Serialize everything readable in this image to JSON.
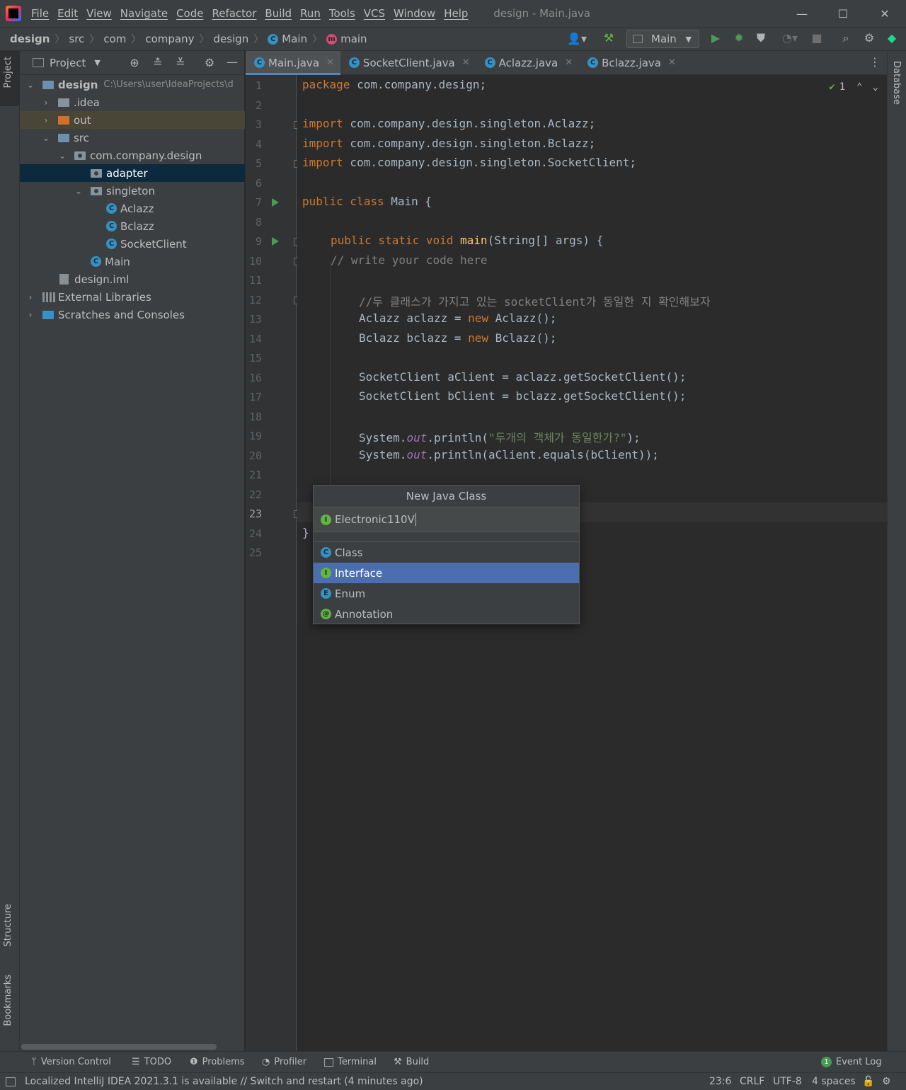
{
  "app": {
    "window_title": "design - Main.java",
    "menu": [
      "File",
      "Edit",
      "View",
      "Navigate",
      "Code",
      "Refactor",
      "Build",
      "Run",
      "Tools",
      "VCS",
      "Window",
      "Help"
    ],
    "window_controls": {
      "minimize": "—",
      "maximize": "☐",
      "close": "✕"
    }
  },
  "breadcrumbs": [
    "design",
    "src",
    "com",
    "company",
    "design",
    "Main",
    "main"
  ],
  "toolbar": {
    "run_config": "Main",
    "icons": [
      "user-icon",
      "hammer-icon",
      "run-icon",
      "debug-icon",
      "coverage-icon",
      "profile-icon",
      "stop-icon",
      "search-icon",
      "gear-icon",
      "jetbrains-icon"
    ]
  },
  "left_stripe": {
    "project_tab": "Project",
    "structure_tab": "Structure",
    "bookmarks_tab": "Bookmarks"
  },
  "right_stripe": {
    "database_tab": "Database"
  },
  "project_panel": {
    "title": "Project",
    "root_name": "design",
    "root_path": "C:\\Users\\user\\IdeaProjects\\d",
    "items": [
      {
        "label": ".idea",
        "type": "folder"
      },
      {
        "label": "out",
        "type": "folder-orange"
      },
      {
        "label": "src",
        "type": "folder-blue"
      },
      {
        "label": "com.company.design",
        "type": "package"
      },
      {
        "label": "adapter",
        "type": "package"
      },
      {
        "label": "singleton",
        "type": "package"
      },
      {
        "label": "Aclazz",
        "type": "class"
      },
      {
        "label": "Bclazz",
        "type": "class"
      },
      {
        "label": "SocketClient",
        "type": "class"
      },
      {
        "label": "Main",
        "type": "class-main"
      },
      {
        "label": "design.iml",
        "type": "file"
      },
      {
        "label": "External Libraries",
        "type": "library"
      },
      {
        "label": "Scratches and Consoles",
        "type": "scratch"
      }
    ]
  },
  "tabs": [
    {
      "label": "Main.java",
      "active": true
    },
    {
      "label": "SocketClient.java",
      "active": false
    },
    {
      "label": "Aclazz.java",
      "active": false
    },
    {
      "label": "Bclazz.java",
      "active": false
    }
  ],
  "editor": {
    "inspection_count": "1",
    "current_line": 23,
    "line_numbers": [
      "1",
      "2",
      "3",
      "4",
      "5",
      "6",
      "7",
      "8",
      "9",
      "10",
      "11",
      "12",
      "13",
      "14",
      "15",
      "16",
      "17",
      "18",
      "19",
      "20",
      "21",
      "22",
      "23",
      "24",
      "25"
    ],
    "code": {
      "l1_kw": "package",
      "l1_rest": " com.company.design;",
      "l3_kw": "import",
      "l3_rest": " com.company.design.singleton.Aclazz;",
      "l4_kw": "import",
      "l4_rest": " com.company.design.singleton.Bclazz;",
      "l5_kw": "import",
      "l5_rest": " com.company.design.singleton.SocketClient;",
      "l7_kw": "public class",
      "l7_rest": " Main {",
      "l9_kw": "public static void",
      "l9_fn": " main",
      "l9_rest": "(String[] args) {",
      "l10": "// write your code here",
      "l12": "//두 클래스가 가지고 있는 socketClient가 동일한 지 확인해보자",
      "l13_a": "Aclazz aclazz = ",
      "l13_kw": "new",
      "l13_b": " Aclazz();",
      "l14_a": "Bclazz bclazz = ",
      "l14_kw": "new",
      "l14_b": " Bclazz();",
      "l16": "SocketClient aClient = aclazz.getSocketClient();",
      "l17": "SocketClient bClient = bclazz.getSocketClient();",
      "l19_a": "System.",
      "l19_fld": "out",
      "l19_b": ".println(",
      "l19_str": "\"두개의 객체가 동일한가?\"",
      "l19_c": ");",
      "l20_a": "System.",
      "l20_fld": "out",
      "l20_b": ".println(aClient.equals(bClient));",
      "l24": "}"
    }
  },
  "popup": {
    "title": "New Java Class",
    "input_value": "Electronic110V",
    "options": [
      "Class",
      "Interface",
      "Enum",
      "Annotation"
    ],
    "selected": "Interface"
  },
  "tool_windows": [
    "Version Control",
    "TODO",
    "Problems",
    "Profiler",
    "Terminal",
    "Build",
    "Event Log"
  ],
  "event_log_count": "1",
  "status_bar": {
    "message": "Localized IntelliJ IDEA 2021.3.1 is available // Switch and restart (4 minutes ago)",
    "position": "23:6",
    "line_sep": "CRLF",
    "encoding": "UTF-8",
    "indent": "4 spaces"
  }
}
